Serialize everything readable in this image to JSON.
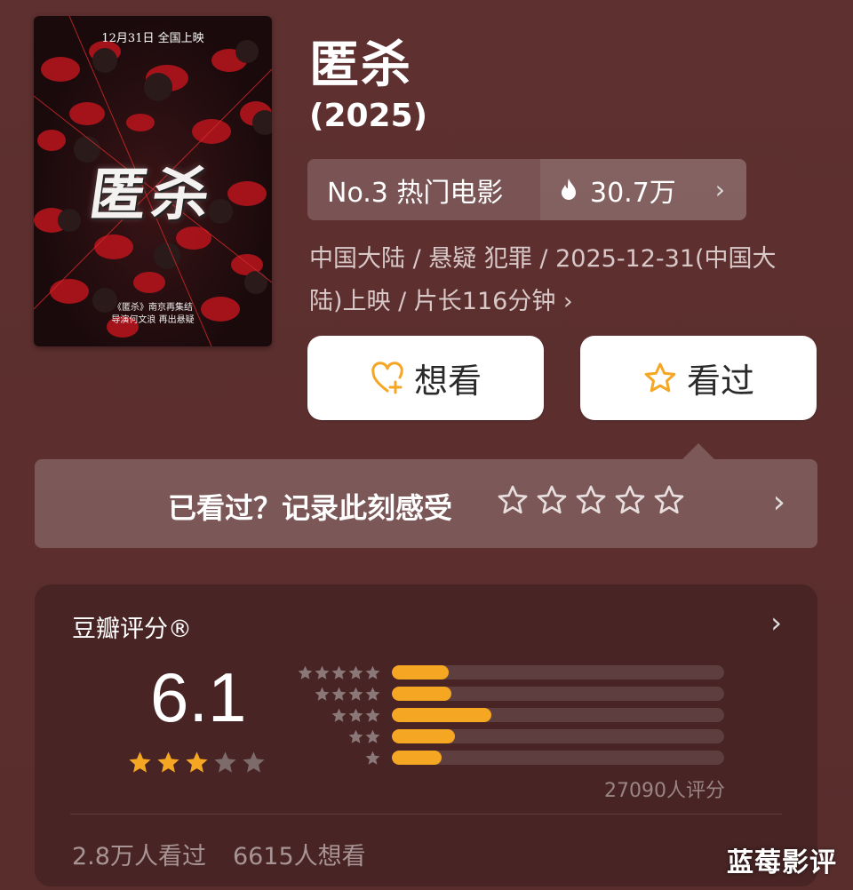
{
  "poster": {
    "date_line": "12月31日 全国上映",
    "title_art": "匿杀",
    "credit_line1": "《匿杀》南京再集结",
    "credit_line2": "导演何文浪 再出悬疑"
  },
  "movie": {
    "title": "匿杀",
    "year": "(2025)"
  },
  "rank": {
    "label": "No.3 热门电影",
    "heat": "30.7万",
    "chevron": "›"
  },
  "meta": {
    "line": "中国大陆 / 悬疑 犯罪 / 2025-12-31(中国大陆)上映 / 片长116分钟 ›"
  },
  "actions": {
    "want_label": "想看",
    "seen_label": "看过"
  },
  "rate_prompt": {
    "text": "已看过？记录此刻感受",
    "chevron": "›"
  },
  "score_card": {
    "title": "豆瓣评分®",
    "chevron": "›",
    "score": "6.1",
    "stars_filled": 3,
    "stars_total": 5,
    "distribution": [
      {
        "stars": 5,
        "fraction": 0.17
      },
      {
        "stars": 4,
        "fraction": 0.18
      },
      {
        "stars": 3,
        "fraction": 0.3
      },
      {
        "stars": 2,
        "fraction": 0.19
      },
      {
        "stars": 1,
        "fraction": 0.15
      }
    ],
    "raters": "27090人评分",
    "seen_count": "2.8万人看过",
    "want_count": "6615人想看"
  },
  "watermark": "蓝莓影评",
  "colors": {
    "background": "#5a2e2e",
    "accent": "#f5a623",
    "button_bg": "#ffffff"
  }
}
